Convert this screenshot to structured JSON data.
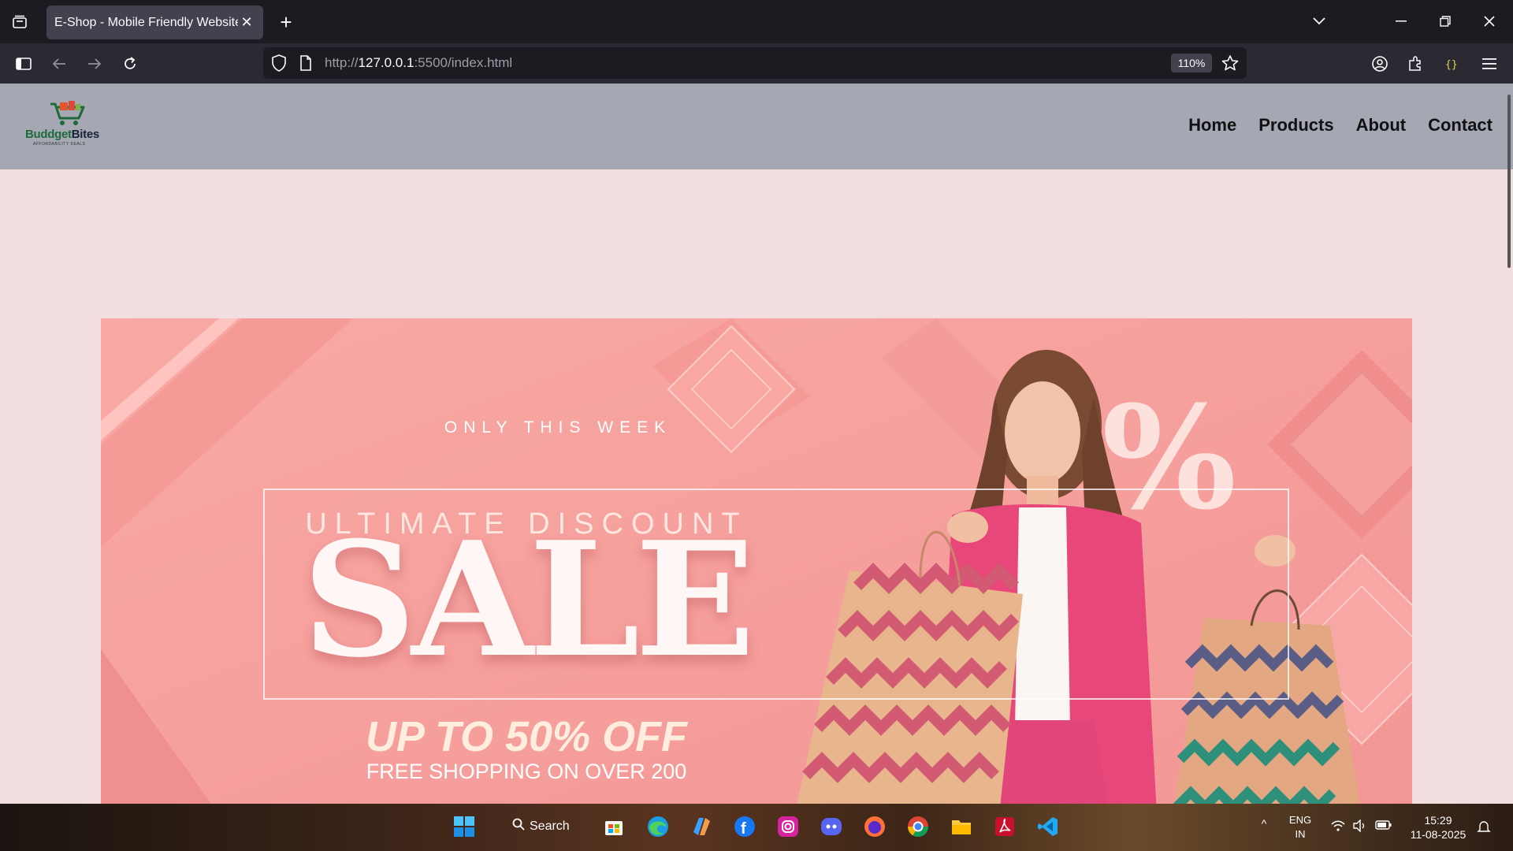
{
  "browser": {
    "tab_title": "E-Shop - Mobile Friendly Website",
    "url_prefix": "http://",
    "url_host": "127.0.0.1",
    "url_path": ":5500/index.html",
    "zoom": "110%"
  },
  "site": {
    "logo_text_part1": "Buddget",
    "logo_text_part2": "Bites",
    "logo_tagline": "AFFORDABILITY DEALS",
    "menu": [
      "Home",
      "Products",
      "About",
      "Contact"
    ]
  },
  "banner": {
    "eyebrow": "ONLY THIS WEEK",
    "subtitle": "ULTIMATE DISCOUNT",
    "headline": "SALE",
    "offer": "UP TO 50% OFF",
    "footnote": "FREE SHOPPING ON OVER 200",
    "percent_symbol": "%"
  },
  "taskbar": {
    "search_label": "Search",
    "language": "ENG",
    "region": "IN",
    "time": "15:29",
    "date": "11-08-2025"
  },
  "colors": {
    "banner_bg": "#f6a3a3",
    "page_bg": "#f2dede",
    "header_bg": "#a5a7b2"
  }
}
